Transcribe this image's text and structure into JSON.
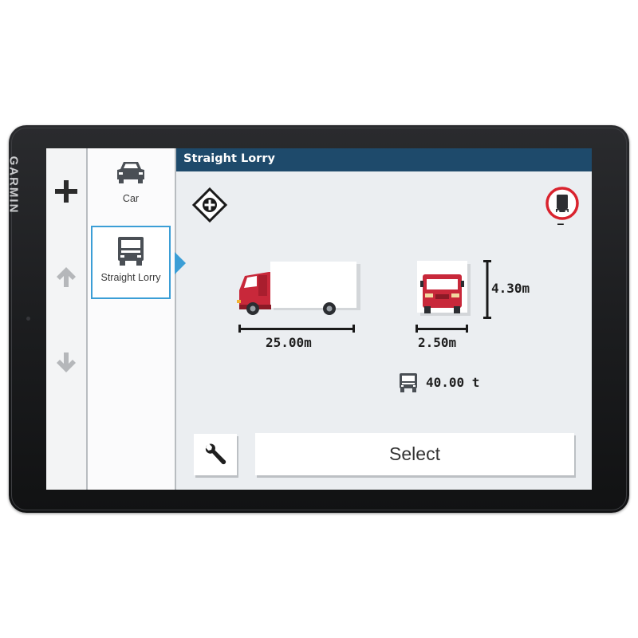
{
  "device": {
    "brand": "GARMIN"
  },
  "controls": [
    {
      "name": "add-button",
      "icon": "plus-icon"
    },
    {
      "name": "scroll-up-button",
      "icon": "arrow-up-icon"
    },
    {
      "name": "scroll-down-button",
      "icon": "arrow-down-icon"
    }
  ],
  "vehicle_list": {
    "items": [
      {
        "label": "Car",
        "icon": "car-icon",
        "selected": false
      },
      {
        "label": "Straight Lorry",
        "icon": "lorry-icon",
        "selected": true
      }
    ]
  },
  "main": {
    "title": "Straight Lorry",
    "hazmat_badge": "–",
    "length": "25.00m",
    "width": "2.50m",
    "height": "4.30m",
    "weight": "40.00 t",
    "select_label": "Select"
  },
  "colors": {
    "title_bar": "#1e4a6b",
    "accent": "#3b9ed6",
    "truck_red": "#c8283a",
    "warning_red": "#d9232e"
  }
}
